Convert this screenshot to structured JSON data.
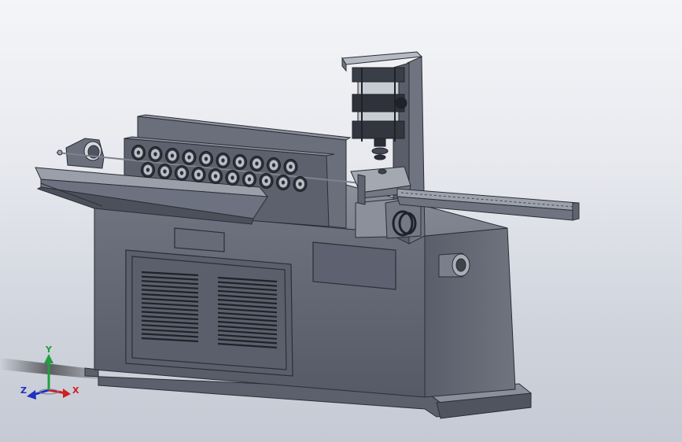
{
  "viewport": {
    "background_top": "#f4f5f8",
    "background_bottom": "#c6cad4"
  },
  "model": {
    "body_color": "#616673",
    "body_dark": "#3f434c",
    "body_light": "#8a8f9b",
    "detail_color": "#2b2e35"
  },
  "triad": {
    "x_label": "X",
    "y_label": "Y",
    "z_label": "Z",
    "x_color": "#cc2020",
    "y_color": "#20a040",
    "z_color": "#2030c0"
  }
}
